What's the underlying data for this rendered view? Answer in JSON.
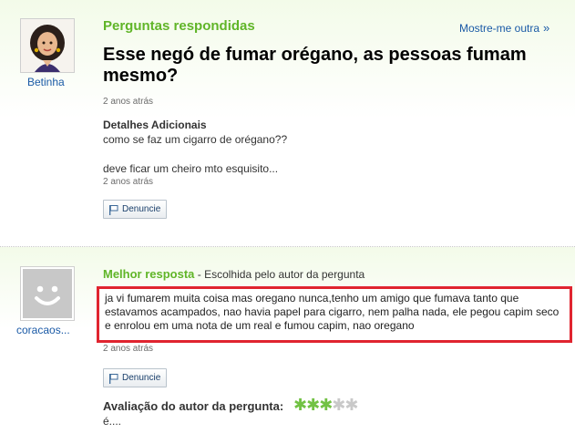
{
  "question": {
    "section_title": "Perguntas respondidas",
    "more_link": "Mostre-me outra",
    "more_chevron": "»",
    "user_name": "Betinha",
    "title": "Esse negó de fumar orégano, as pessoas fumam mesmo?",
    "timestamp": "2 anos atrás",
    "details_label": "Detalhes Adicionais",
    "details_line1": "como se faz um cigarro de orégano??",
    "details_line2": "deve ficar um cheiro mto esquisito...",
    "details_timestamp": "2 anos atrás",
    "report_label": "Denuncie"
  },
  "answer": {
    "user_name": "coracaos...",
    "best_label": "Melhor resposta",
    "best_sub": " - Escolhida pelo autor da pergunta",
    "text": "ja vi fumarem muita coisa mas oregano nunca,tenho um amigo que fumava tanto que estavamos acampados, nao havia papel para cigarro, nem palha nada, ele pegou capim seco e enrolou em uma nota de um real e fumou capim, nao oregano",
    "timestamp": "2 anos atrás",
    "report_label": "Denuncie",
    "rating_label": "Avaliação do autor da pergunta:",
    "rating_stars": 3,
    "rating_max": 5,
    "rating_comment": "é...."
  },
  "colors": {
    "accent_green": "#60b528",
    "link_blue": "#1a5aa6",
    "highlight_red": "#e0242f"
  }
}
